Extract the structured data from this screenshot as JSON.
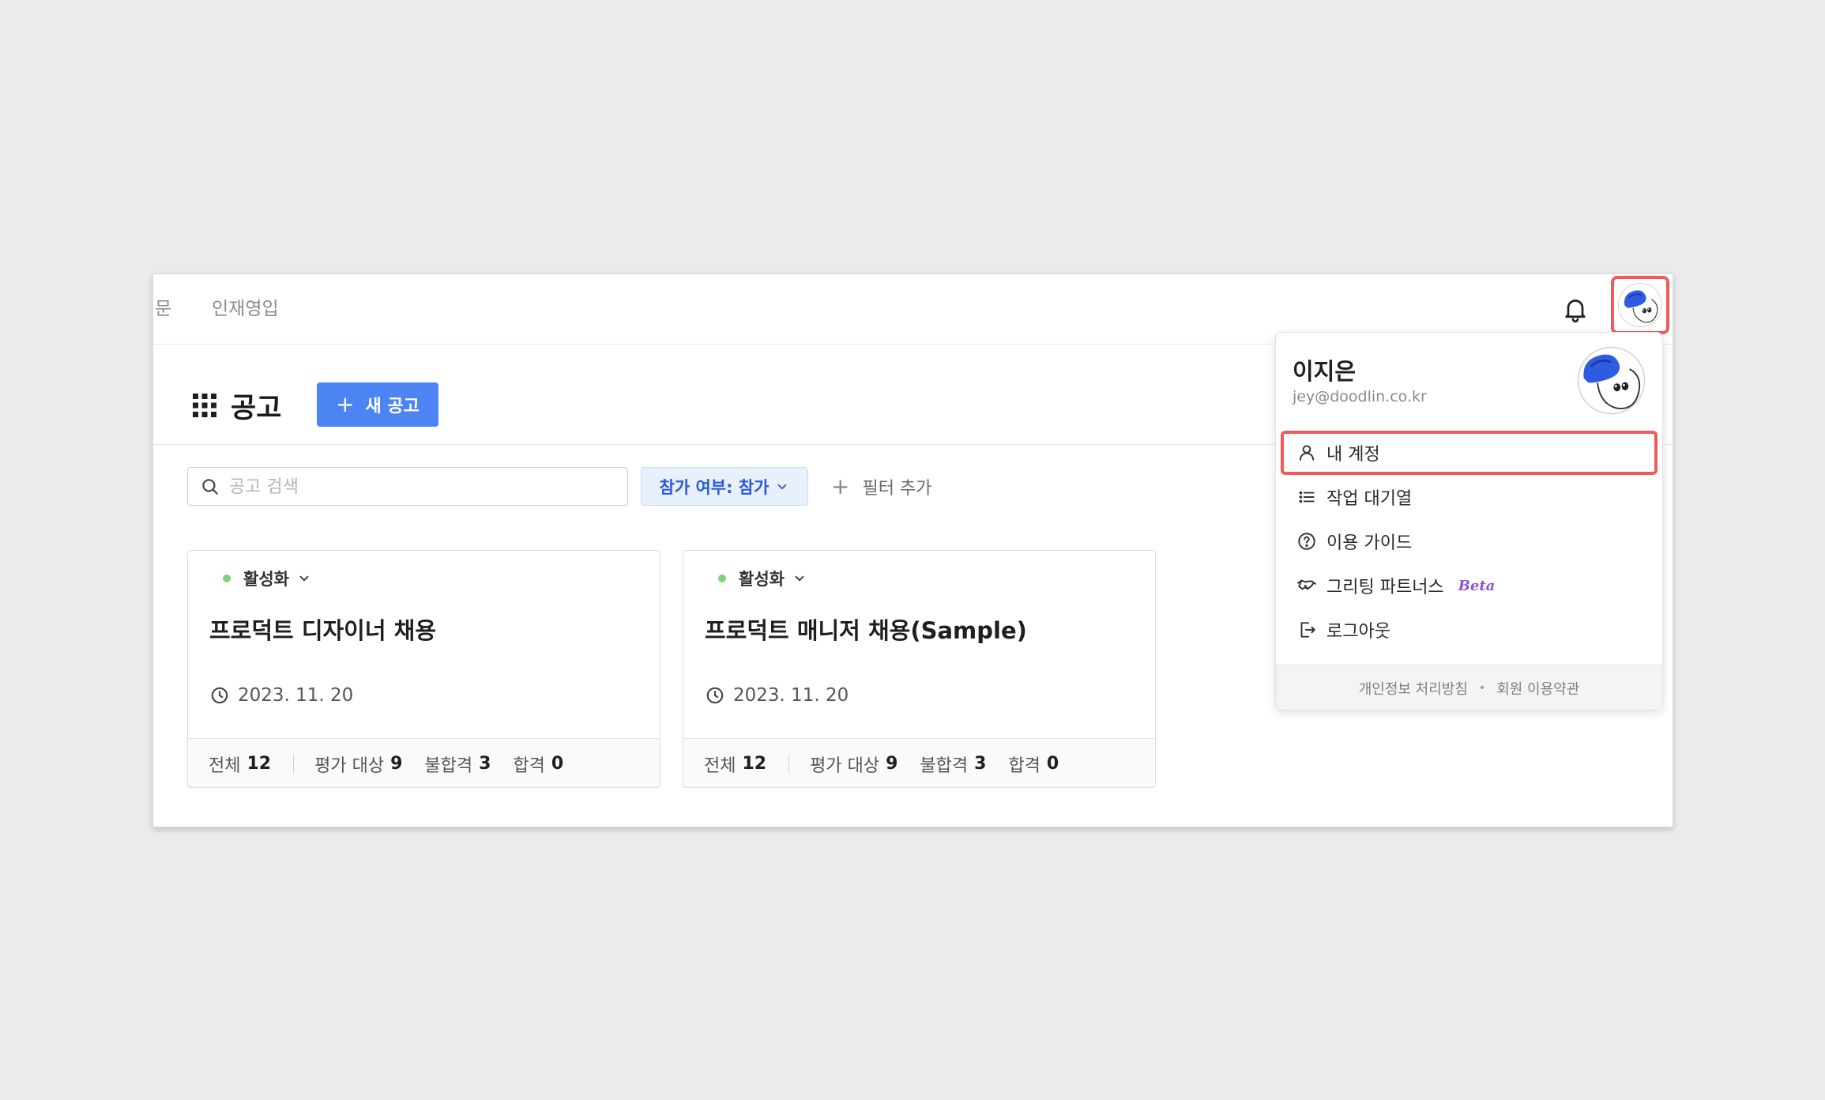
{
  "nav": {
    "partial_item": "문",
    "hr_item": "인재영입"
  },
  "header": {
    "title": "공고",
    "new_button_label": "새 공고"
  },
  "filters": {
    "search_placeholder": "공고 검색",
    "participation_chip": "참가 여부: 참가",
    "add_filter_label": "필터 추가"
  },
  "cards": [
    {
      "status": "활성화",
      "title": "프로덕트 디자이너 채용",
      "date": "2023. 11. 20",
      "total_label": "전체",
      "total": "12",
      "eval_label": "평가 대상",
      "eval": "9",
      "fail_label": "불합격",
      "fail": "3",
      "pass_label": "합격",
      "pass": "0"
    },
    {
      "status": "활성화",
      "title": "프로덕트 매니저 채용(Sample)",
      "date": "2023. 11. 20",
      "total_label": "전체",
      "total": "12",
      "eval_label": "평가 대상",
      "eval": "9",
      "fail_label": "불합격",
      "fail": "3",
      "pass_label": "합격",
      "pass": "0"
    }
  ],
  "profile_menu": {
    "name": "이지은",
    "email": "jey@doodlin.co.kr",
    "items": [
      {
        "label": "내 계정",
        "icon": "user-icon"
      },
      {
        "label": "작업 대기열",
        "icon": "list-icon"
      },
      {
        "label": "이용 가이드",
        "icon": "help-circle-icon"
      },
      {
        "label": "그리팅 파트너스",
        "icon": "handshake-icon",
        "badge": "Beta"
      },
      {
        "label": "로그아웃",
        "icon": "logout-icon"
      }
    ],
    "footer_privacy": "개인정보 처리방침",
    "footer_terms": "회원 이용약관"
  },
  "colors": {
    "accent_blue": "#4d84f3",
    "highlight_red": "#ef5b5b",
    "active_green": "#7dd37d",
    "beta_purple": "#8a55d6"
  }
}
